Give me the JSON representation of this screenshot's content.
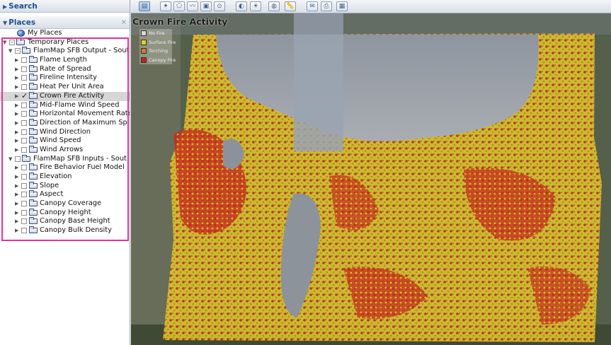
{
  "search": {
    "label": "Search"
  },
  "places": {
    "label": "Places",
    "close": "×"
  },
  "tree": {
    "my_places": "My Places",
    "temporary_places": "Temporary Places",
    "output_folder": "FlamMap SFB Output - Sout...",
    "output_items": [
      {
        "label": "Flame Length",
        "checked": false
      },
      {
        "label": "Rate of Spread",
        "checked": false
      },
      {
        "label": "Fireline Intensity",
        "checked": false
      },
      {
        "label": "Heat Per Unit Area",
        "checked": false
      },
      {
        "label": "Crown Fire Activity",
        "checked": true,
        "selected": true
      },
      {
        "label": "Mid-Flame Wind Speed",
        "checked": false
      },
      {
        "label": "Horizontal Movement Rate",
        "checked": false
      },
      {
        "label": "Direction of Maximum Sp...",
        "checked": false
      },
      {
        "label": "Wind Direction",
        "checked": false
      },
      {
        "label": "Wind Speed",
        "checked": false
      },
      {
        "label": "Wind Arrows",
        "checked": false
      }
    ],
    "input_folder": "FlamMap SFB Inputs - Sout...",
    "input_items": [
      {
        "label": "Fire Behavior Fuel Model"
      },
      {
        "label": "Elevation"
      },
      {
        "label": "Slope"
      },
      {
        "label": "Aspect"
      },
      {
        "label": "Canopy Coverage"
      },
      {
        "label": "Canopy Height"
      },
      {
        "label": "Canopy Base Height"
      },
      {
        "label": "Canopy Bulk Density"
      }
    ]
  },
  "toolbar": {
    "buttons": [
      "sidebar-toggle-icon",
      "placemark-icon",
      "polygon-icon",
      "path-icon",
      "image-overlay-icon",
      "record-tour-icon",
      "historical-imagery-icon",
      "sun-icon",
      "planets-icon",
      "ruler-icon",
      "email-icon",
      "print-icon",
      "save-image-icon"
    ]
  },
  "map": {
    "title": "Crown Fire Activity",
    "legend": [
      {
        "label": "No Fire",
        "color": "#d8d8d8"
      },
      {
        "label": "Surface Fire",
        "color": "#e5d21f"
      },
      {
        "label": "Torching",
        "color": "#d07a2a"
      },
      {
        "label": "Canopy Fire",
        "color": "#c4221c"
      }
    ]
  }
}
